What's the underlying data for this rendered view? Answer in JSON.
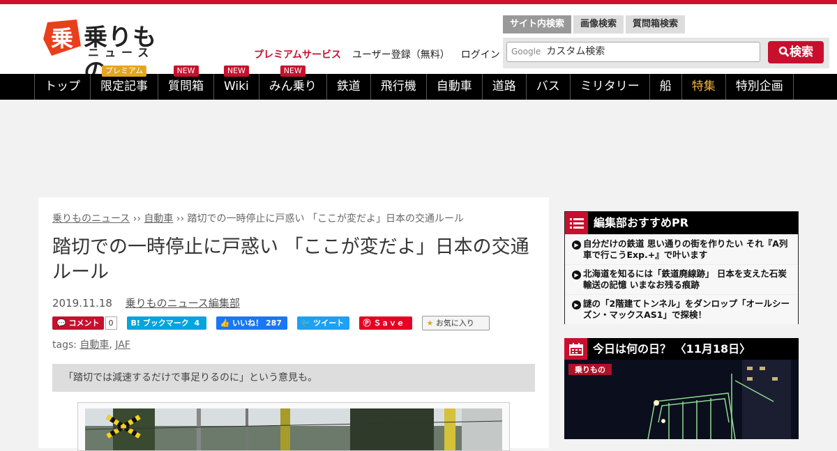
{
  "header": {
    "logo_line1": "乗りもの",
    "logo_line2": "ニュース",
    "logo_badge": "乗",
    "premium_link": "プレミアムサービス",
    "register_link": "ユーザー登録（無料）",
    "login_link": "ログイン",
    "search_tabs": [
      "サイト内検索",
      "画像検索",
      "質問箱検索"
    ],
    "search_google": "Google",
    "search_placeholder": "カスタム検索",
    "search_button": "検索"
  },
  "nav": {
    "items": [
      {
        "label": "トップ",
        "badge": ""
      },
      {
        "label": "限定記事",
        "badge": "プレミアム"
      },
      {
        "label": "質問箱",
        "badge": "NEW"
      },
      {
        "label": "Wiki",
        "badge": "NEW"
      },
      {
        "label": "みん乗り",
        "badge": "NEW"
      },
      {
        "label": "鉄道",
        "badge": ""
      },
      {
        "label": "飛行機",
        "badge": ""
      },
      {
        "label": "自動車",
        "badge": ""
      },
      {
        "label": "道路",
        "badge": ""
      },
      {
        "label": "バス",
        "badge": ""
      },
      {
        "label": "ミリタリー",
        "badge": ""
      },
      {
        "label": "船",
        "badge": ""
      },
      {
        "label": "特集",
        "badge": ""
      },
      {
        "label": "特別企画",
        "badge": ""
      }
    ]
  },
  "article": {
    "breadcrumb": [
      "乗りものニュース",
      "自動車",
      "踏切での一時停止に戸惑い 「ここが変だよ」日本の交通ルール"
    ],
    "breadcrumb_sep": "››",
    "title": "踏切での一時停止に戸惑い 「ここが変だよ」日本の交通ルール",
    "date": "2019.11.18",
    "author": "乗りものニュース編集部",
    "share": {
      "comment_label": "コメント",
      "comment_count": "0",
      "hatena_label": "B! ブックマーク",
      "hatena_count": "4",
      "fb_label": "いいね！",
      "fb_count": "287",
      "tweet_label": "ツイート",
      "pin_label": "Ｓａｖｅ",
      "fav_label": "お気に入り"
    },
    "tags_label": "tags:",
    "tags": [
      "自動車",
      "JAF"
    ],
    "lead": "「踏切では減速するだけで事足りるのに」という意見も。"
  },
  "sidebar": {
    "pr_title": "編集部おすすめPR",
    "pr_items": [
      "自分だけの鉄道 思い通りの街を作りたい それ『A列車で行こうExp.+』で叶います",
      "北海道を知るには「鉄道廃線跡」 日本を支えた石炭輸送の記憶 いまなお残る痕跡",
      "謎の「2階建てトンネル」をダンロップ「オールシーズン・マックスAS1」で探検！"
    ],
    "today_title": "今日は何の日？ 〈11月18日〉",
    "today_logo": "乗りもの"
  },
  "colors": {
    "brand_red": "#c8102e",
    "nav_bg": "#000000",
    "feature": "#f0b43c"
  }
}
